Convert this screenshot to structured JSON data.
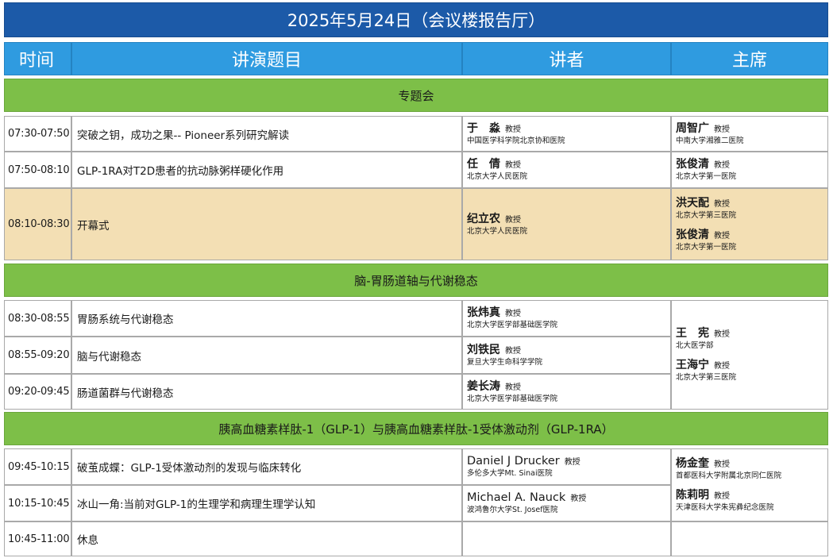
{
  "banner": "2025年5月24日（会议楼报告厅）",
  "headers": {
    "time": "时间",
    "topic": "讲演题目",
    "speaker": "讲者",
    "chair": "主席"
  },
  "sections": [
    "专题会",
    "脑-胃肠道轴与代谢稳态",
    "胰高血糖素样肽-1（GLP-1）与胰高血糖素样肽-1受体激动剂（GLP-1RA）"
  ],
  "title_suffix": "教授",
  "rows": [
    {
      "time": "07:30-07:50",
      "topic": "突破之钥，成功之果-- Pioneer系列研究解读",
      "speaker": {
        "name": "于　淼",
        "aff": "中国医学科学院北京协和医院"
      }
    },
    {
      "time": "07:50-08:10",
      "topic": "GLP-1RA对T2D患者的抗动脉粥样硬化作用",
      "speaker": {
        "name": "任　倩",
        "aff": "北京大学人民医院"
      }
    },
    {
      "time": "08:10-08:30",
      "topic": "开幕式",
      "speaker": {
        "name": "纪立农",
        "aff": "北京大学人民医院"
      }
    },
    {
      "time": "08:30-08:55",
      "topic": "胃肠系统与代谢稳态",
      "speaker": {
        "name": "张炜真",
        "aff": "北京大学医学部基础医学院"
      }
    },
    {
      "time": "08:55-09:20",
      "topic": "脑与代谢稳态",
      "speaker": {
        "name": "刘铁民",
        "aff": "复旦大学生命科学学院"
      }
    },
    {
      "time": "09:20-09:45",
      "topic": "肠道菌群与代谢稳态",
      "speaker": {
        "name": "姜长涛",
        "aff": "北京大学医学部基础医学院"
      }
    },
    {
      "time": "09:45-10:15",
      "topic": "破茧成蝶：GLP-1受体激动剂的发现与临床转化",
      "speaker": {
        "name": "Daniel J Drucker",
        "aff": "多伦多大学Mt. Sinai医院"
      }
    },
    {
      "time": "10:15-10:45",
      "topic": "冰山一角:当前对GLP-1的生理学和病理生理学认知",
      "speaker": {
        "name": "Michael A. Nauck",
        "aff": "波鸿鲁尔大学St. Josef医院"
      }
    },
    {
      "time": "10:45-11:00",
      "topic": "休息"
    }
  ],
  "chairs": [
    {
      "name": "周智广",
      "aff": "中南大学湘雅二医院"
    },
    {
      "name": "张俊清",
      "aff": "北京大学第一医院"
    },
    {
      "name": "洪天配",
      "aff": "北京大学第三医院"
    },
    {
      "name": "张俊清",
      "aff": "北京大学第一医院"
    },
    {
      "name": "王　宪",
      "aff": "北大医学部"
    },
    {
      "name": "王海宁",
      "aff": "北京大学第三医院"
    },
    {
      "name": "杨金奎",
      "aff": "首都医科大学附属北京同仁医院"
    },
    {
      "name": "陈莉明",
      "aff": "天津医科大学朱宪彝纪念医院"
    }
  ]
}
